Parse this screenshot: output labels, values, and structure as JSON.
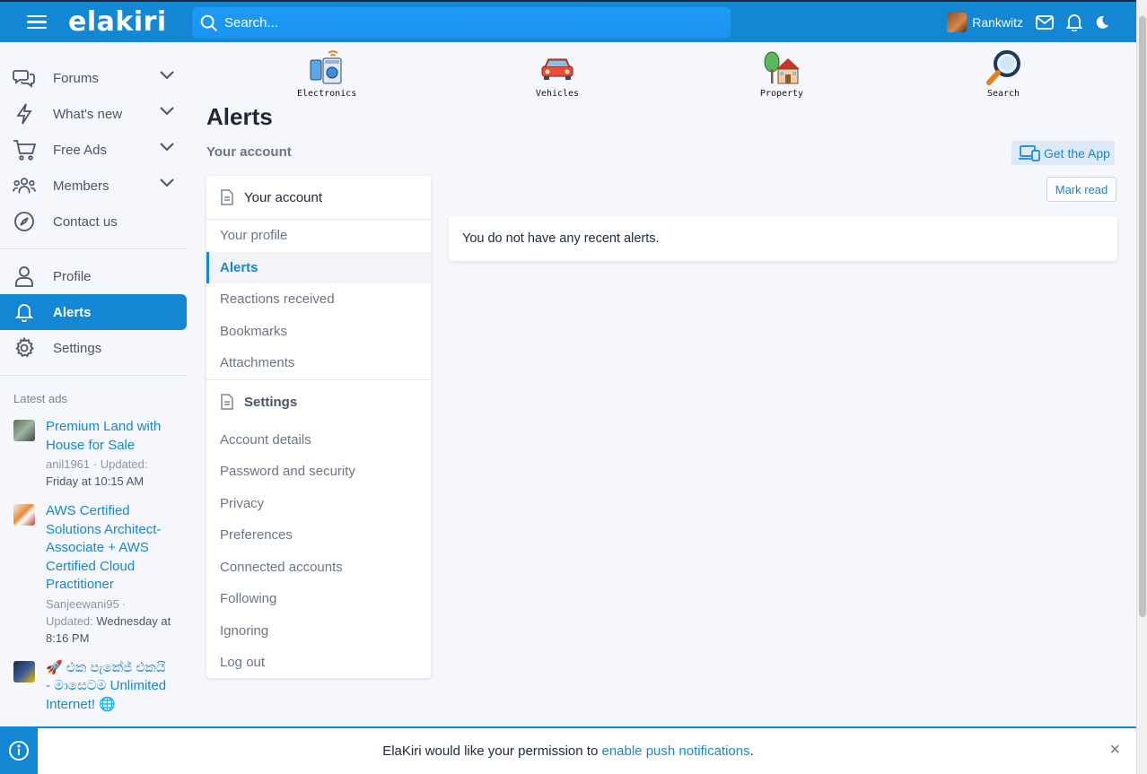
{
  "brand": {
    "logo": "elakiri",
    "accent": "#1387d4"
  },
  "header": {
    "search_placeholder": "Search...",
    "username": "Rankwitz",
    "icons": [
      "menu-icon",
      "search-icon",
      "mail-icon",
      "bell-icon",
      "moon-icon"
    ]
  },
  "sidebar": {
    "items": [
      {
        "label": "Forums",
        "icon": "chat-bubbles-icon",
        "has_submenu": true
      },
      {
        "label": "What's new",
        "icon": "lightning-icon",
        "has_submenu": true
      },
      {
        "label": "Free Ads",
        "icon": "cart-icon",
        "has_submenu": true
      },
      {
        "label": "Members",
        "icon": "users-icon",
        "has_submenu": true
      },
      {
        "label": "Contact us",
        "icon": "compass-icon",
        "has_submenu": false
      }
    ],
    "account_items": [
      {
        "label": "Profile",
        "icon": "user-icon"
      },
      {
        "label": "Alerts",
        "icon": "bell-icon",
        "active": true
      },
      {
        "label": "Settings",
        "icon": "gear-icon"
      }
    ],
    "latest_title": "Latest ads",
    "latest_ads": [
      {
        "title": "Premium Land with House for Sale",
        "author": "anil1961",
        "updated_label": "Updated:",
        "updated": "Friday at 10:15 AM"
      },
      {
        "title": "AWS Certified Solutions Architect-Associate + AWS Certified Cloud Practitioner",
        "author": "Sanjeewani95",
        "updated_label": "Updated:",
        "updated": "Wednesday at 8:16 PM"
      },
      {
        "title": "🚀 එක පැකේජ් එකයි - මාසෙටම Unlimited Internet! 🌐",
        "author": "",
        "updated_label": "",
        "updated": ""
      }
    ]
  },
  "categories": [
    {
      "label": "Electronics",
      "icon": "electronics-icon"
    },
    {
      "label": "Vehicles",
      "icon": "car-icon"
    },
    {
      "label": "Property",
      "icon": "house-icon"
    },
    {
      "label": "Search",
      "icon": "magnifier-icon"
    }
  ],
  "main": {
    "title": "Alerts",
    "breadcrumb": "Your account",
    "get_app_label": "Get the App",
    "mark_read_label": "Mark read",
    "empty_message": "You do not have any recent alerts."
  },
  "account_menu": {
    "header": "Your account",
    "links": [
      "Your profile",
      "Alerts",
      "Reactions received",
      "Bookmarks",
      "Attachments"
    ],
    "active_link": "Alerts",
    "settings_header": "Settings",
    "settings_links": [
      "Account details",
      "Password and security",
      "Privacy",
      "Preferences",
      "Connected accounts",
      "Following",
      "Ignoring",
      "Log out"
    ]
  },
  "notice": {
    "prefix": "ElaKiri would like your permission to",
    "link": "enable push notifications",
    "suffix": ".",
    "close": "×"
  }
}
